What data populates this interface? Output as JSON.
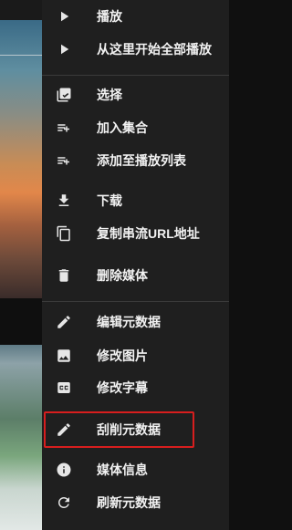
{
  "menu": {
    "items": [
      {
        "label": "播放",
        "icon": "play-icon"
      },
      {
        "label": "从这里开始全部播放",
        "icon": "play-all-icon"
      },
      {
        "label": "选择",
        "icon": "select-icon"
      },
      {
        "label": "加入集合",
        "icon": "add-to-collection-icon"
      },
      {
        "label": "添加至播放列表",
        "icon": "add-to-playlist-icon"
      },
      {
        "label": "下载",
        "icon": "download-icon"
      },
      {
        "label": "复制串流URL地址",
        "icon": "copy-icon"
      },
      {
        "label": "删除媒体",
        "icon": "delete-icon"
      },
      {
        "label": "编辑元数据",
        "icon": "edit-icon"
      },
      {
        "label": "修改图片",
        "icon": "image-icon"
      },
      {
        "label": "修改字幕",
        "icon": "subtitles-icon"
      },
      {
        "label": "刮削元数据",
        "icon": "edit-icon"
      },
      {
        "label": "媒体信息",
        "icon": "info-icon"
      },
      {
        "label": "刷新元数据",
        "icon": "refresh-icon"
      }
    ]
  },
  "colors": {
    "menu_background": "#1f1f1f",
    "text": "#f2f2f2",
    "highlight_border": "#d71e1e"
  }
}
